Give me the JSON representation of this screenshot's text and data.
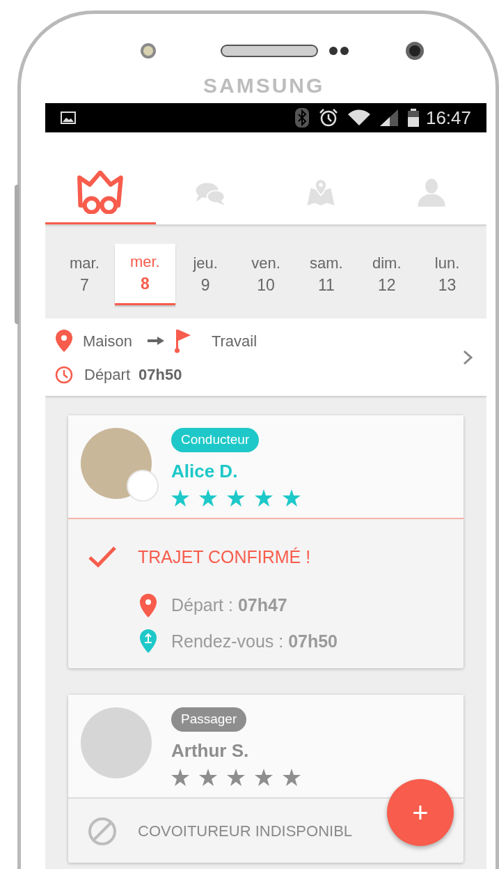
{
  "device": {
    "brand": "SAMSUNG"
  },
  "status_bar": {
    "time": "16:47"
  },
  "tabs": [
    {
      "kind": "carpool",
      "selected": true
    },
    {
      "kind": "chat",
      "selected": false
    },
    {
      "kind": "map",
      "selected": false
    },
    {
      "kind": "profile",
      "selected": false
    }
  ],
  "days": [
    {
      "day": "mar.",
      "date": "7",
      "selected": false
    },
    {
      "day": "mer.",
      "date": "8",
      "selected": true
    },
    {
      "day": "jeu.",
      "date": "9",
      "selected": false
    },
    {
      "day": "ven.",
      "date": "10",
      "selected": false
    },
    {
      "day": "sam.",
      "date": "11",
      "selected": false
    },
    {
      "day": "dim.",
      "date": "12",
      "selected": false
    },
    {
      "day": "lun.",
      "date": "13",
      "selected": false
    }
  ],
  "route": {
    "from": "Maison",
    "to": "Travail",
    "departure_label": "Départ",
    "departure_time": "07h50"
  },
  "cards": [
    {
      "kind": "driver",
      "role": "Conducteur",
      "name": "Alice D.",
      "stars": 5,
      "status": {
        "kind": "confirmed",
        "text": "TRAJET CONFIRMÉ !"
      },
      "details": [
        {
          "kind": "departure",
          "text": "Départ : **07h47**"
        },
        {
          "kind": "meeting",
          "text": "Rendez-vous : **07h50**"
        }
      ]
    },
    {
      "kind": "passenger",
      "role": "Passager",
      "name": "Arthur S.",
      "stars": 5,
      "status": {
        "kind": "unavailable",
        "text": "COVOITUREUR INDISPONIBL"
      }
    }
  ],
  "fab": {
    "label": "+"
  }
}
